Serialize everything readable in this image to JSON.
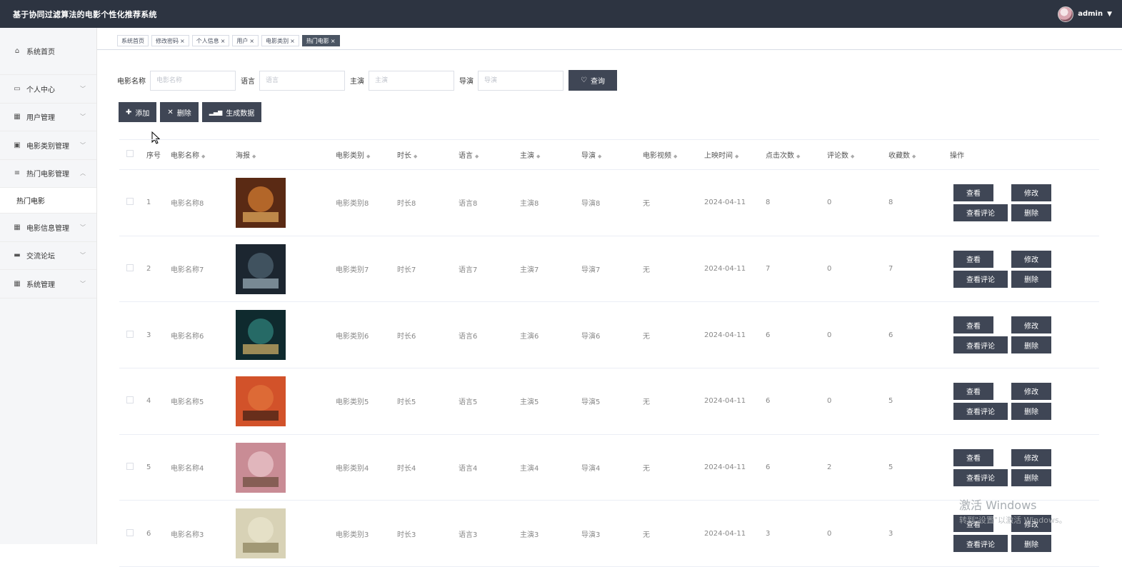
{
  "header": {
    "title": "基于协同过滤算法的电影个性化推荐系统",
    "username": "admin"
  },
  "sidebar": {
    "items": [
      {
        "label": "系统首页",
        "icon": "home-icon"
      },
      {
        "label": "个人中心",
        "icon": "card-icon"
      },
      {
        "label": "用户管理",
        "icon": "grid-icon"
      },
      {
        "label": "电影类别管理",
        "icon": "clipboard-icon"
      },
      {
        "label": "热门电影管理",
        "icon": "sliders-icon"
      },
      {
        "label": "电影信息管理",
        "icon": "apps-icon"
      },
      {
        "label": "交流论坛",
        "icon": "briefcase-icon"
      },
      {
        "label": "系统管理",
        "icon": "grid-icon"
      }
    ],
    "sub_item": "热门电影"
  },
  "tabs": [
    {
      "label": "系统首页",
      "closable": false
    },
    {
      "label": "修改密码",
      "closable": true
    },
    {
      "label": "个人信息",
      "closable": true
    },
    {
      "label": "用户",
      "closable": true
    },
    {
      "label": "电影类别",
      "closable": true
    },
    {
      "label": "热门电影",
      "closable": true,
      "active": true
    }
  ],
  "search": {
    "fields": [
      {
        "label": "电影名称",
        "placeholder": "电影名称"
      },
      {
        "label": "语言",
        "placeholder": "语言"
      },
      {
        "label": "主演",
        "placeholder": "主演"
      },
      {
        "label": "导演",
        "placeholder": "导演"
      }
    ],
    "query_label": "查询"
  },
  "actions": {
    "add_label": "添加",
    "delete_label": "删除",
    "generate_label": "生成数据"
  },
  "table": {
    "headers": {
      "no": "序号",
      "name": "电影名称",
      "poster": "海报",
      "type": "电影类别",
      "duration": "时长",
      "language": "语言",
      "lead": "主演",
      "director": "导演",
      "video": "电影视频",
      "date": "上映时间",
      "clicks": "点击次数",
      "comments": "评论数",
      "favs": "收藏数",
      "ops": "操作"
    },
    "op_labels": {
      "view": "查看",
      "edit": "修改",
      "view_comments": "查看评论",
      "delete": "删除"
    },
    "rows": [
      {
        "no": "1",
        "name": "电影名称8",
        "type": "电影类别8",
        "duration": "时长8",
        "language": "语言8",
        "lead": "主演8",
        "director": "导演8",
        "video": "无",
        "date": "2024-04-11",
        "clicks": "8",
        "comments": "0",
        "favs": "8"
      },
      {
        "no": "2",
        "name": "电影名称7",
        "type": "电影类别7",
        "duration": "时长7",
        "language": "语言7",
        "lead": "主演7",
        "director": "导演7",
        "video": "无",
        "date": "2024-04-11",
        "clicks": "7",
        "comments": "0",
        "favs": "7"
      },
      {
        "no": "3",
        "name": "电影名称6",
        "type": "电影类别6",
        "duration": "时长6",
        "language": "语言6",
        "lead": "主演6",
        "director": "导演6",
        "video": "无",
        "date": "2024-04-11",
        "clicks": "6",
        "comments": "0",
        "favs": "6"
      },
      {
        "no": "4",
        "name": "电影名称5",
        "type": "电影类别5",
        "duration": "时长5",
        "language": "语言5",
        "lead": "主演5",
        "director": "导演5",
        "video": "无",
        "date": "2024-04-11",
        "clicks": "6",
        "comments": "0",
        "favs": "5"
      },
      {
        "no": "5",
        "name": "电影名称4",
        "type": "电影类别4",
        "duration": "时长4",
        "language": "语言4",
        "lead": "主演4",
        "director": "导演4",
        "video": "无",
        "date": "2024-04-11",
        "clicks": "6",
        "comments": "2",
        "favs": "5"
      },
      {
        "no": "6",
        "name": "电影名称3",
        "type": "电影类别3",
        "duration": "时长3",
        "language": "语言3",
        "lead": "主演3",
        "director": "导演3",
        "video": "无",
        "date": "2024-04-11",
        "clicks": "3",
        "comments": "0",
        "favs": "3"
      }
    ]
  },
  "watermark": {
    "line1": "激活 Windows",
    "line2": "转到\"设置\"以激活 Windows。"
  }
}
